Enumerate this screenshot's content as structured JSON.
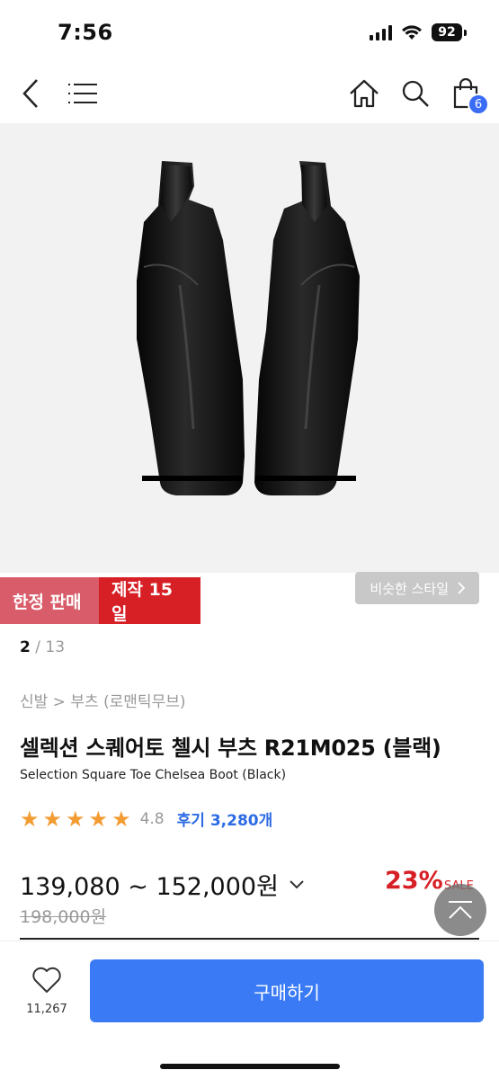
{
  "status": {
    "time": "7:56",
    "battery": "92"
  },
  "nav": {
    "back_icon": "chevron-left-icon",
    "menu_icon": "hamburger-menu-icon",
    "home_icon": "home-icon",
    "search_icon": "search-icon",
    "cart_icon": "shopping-bag-icon",
    "cart_count": "6"
  },
  "product": {
    "image_alt": "black-chelsea-boots",
    "badges": {
      "limited": "한정 판매",
      "made": "제작 15일"
    },
    "similar_style_label": "비슷한 스타일",
    "image_index": {
      "current": "2",
      "separator": "/",
      "total": "13"
    },
    "breadcrumb": "신발 > 부츠 (로맨틱무브)",
    "title_ko": "셀렉션 스퀘어토 첼시 부츠 R21M025 (블랙)",
    "title_en": "Selection Square Toe Chelsea Boot (Black)",
    "rating": {
      "stars": 5,
      "score": "4.8",
      "reviews_label": "후기 3,280개"
    },
    "price_range": "139,080 ~ 152,000원",
    "discount": "23%",
    "sale_label": "SALE",
    "original_price": "198,000원"
  },
  "colors": {
    "accent_blue": "#3a7bf5",
    "sale_red": "#d71f26",
    "limited_pink": "#d95c6a",
    "star_orange": "#f39c33"
  },
  "bottom": {
    "wish_count": "11,267",
    "buy_label": "구매하기"
  }
}
